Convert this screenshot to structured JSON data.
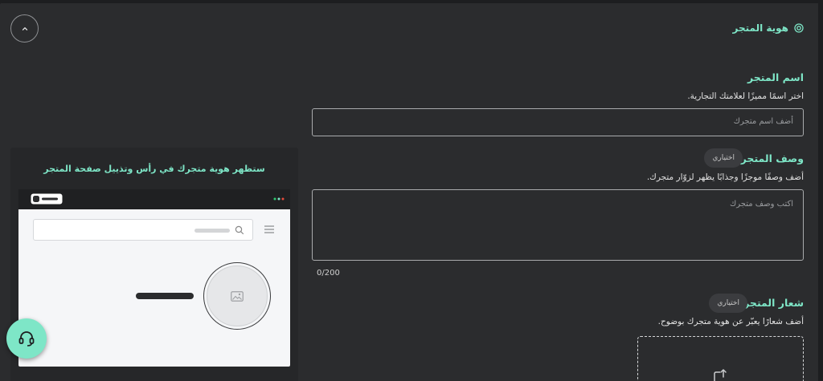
{
  "section": {
    "title": "هوية المتجر",
    "icon": "target-icon"
  },
  "store_name": {
    "label": "اسم المتجر",
    "description": "اختر اسمًا مميزًا لعلامتك التجارية.",
    "placeholder": "أضف اسم متجرك"
  },
  "store_description": {
    "label": "وصف المتجر",
    "optional_badge": "اختياري",
    "description": "أضف وصفًا موجزًا وجذابًا يظهر لزوّار متجرك.",
    "placeholder": "اكتب وصف متجرك",
    "counter": "0/200"
  },
  "store_logo": {
    "label": "شعار المتجر",
    "optional_badge": "اختياري",
    "description": "أضف شعارًا يعبّر عن هوية متجرك بوضوح."
  },
  "preview": {
    "caption": "ستظهر هوية متجرك في رأس وتذييل صفحة المتجر"
  },
  "colors": {
    "accent": "#7ee6c7",
    "panel_bg": "#2b2c2e",
    "page_bg": "#1d1e20"
  }
}
